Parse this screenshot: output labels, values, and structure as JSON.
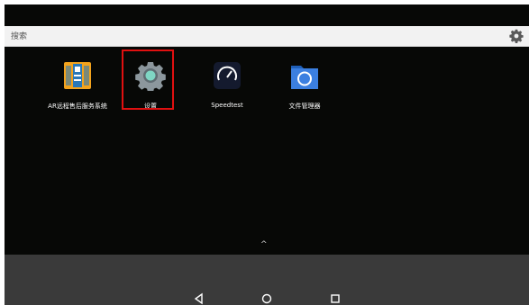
{
  "search": {
    "placeholder": "搜索",
    "settings_icon": "gear-icon"
  },
  "apps": [
    {
      "label": "AR远程售后服务系统",
      "icon": "ar-remote-service-icon"
    },
    {
      "label": "设置",
      "icon": "settings-gear-icon",
      "highlighted": true
    },
    {
      "label": "Speedtest",
      "icon": "speedtest-gauge-icon"
    },
    {
      "label": "文件管理器",
      "icon": "file-manager-folder-icon"
    }
  ],
  "drawer": {
    "caret": "^"
  },
  "navbar": {
    "back_icon": "back-triangle-icon",
    "home_icon": "home-circle-icon",
    "recents_icon": "recents-square-icon"
  },
  "colors": {
    "background": "#070806",
    "search_bar": "#f2f2f2",
    "nav_bar": "#3a3a3a",
    "highlight": "#e01010"
  }
}
